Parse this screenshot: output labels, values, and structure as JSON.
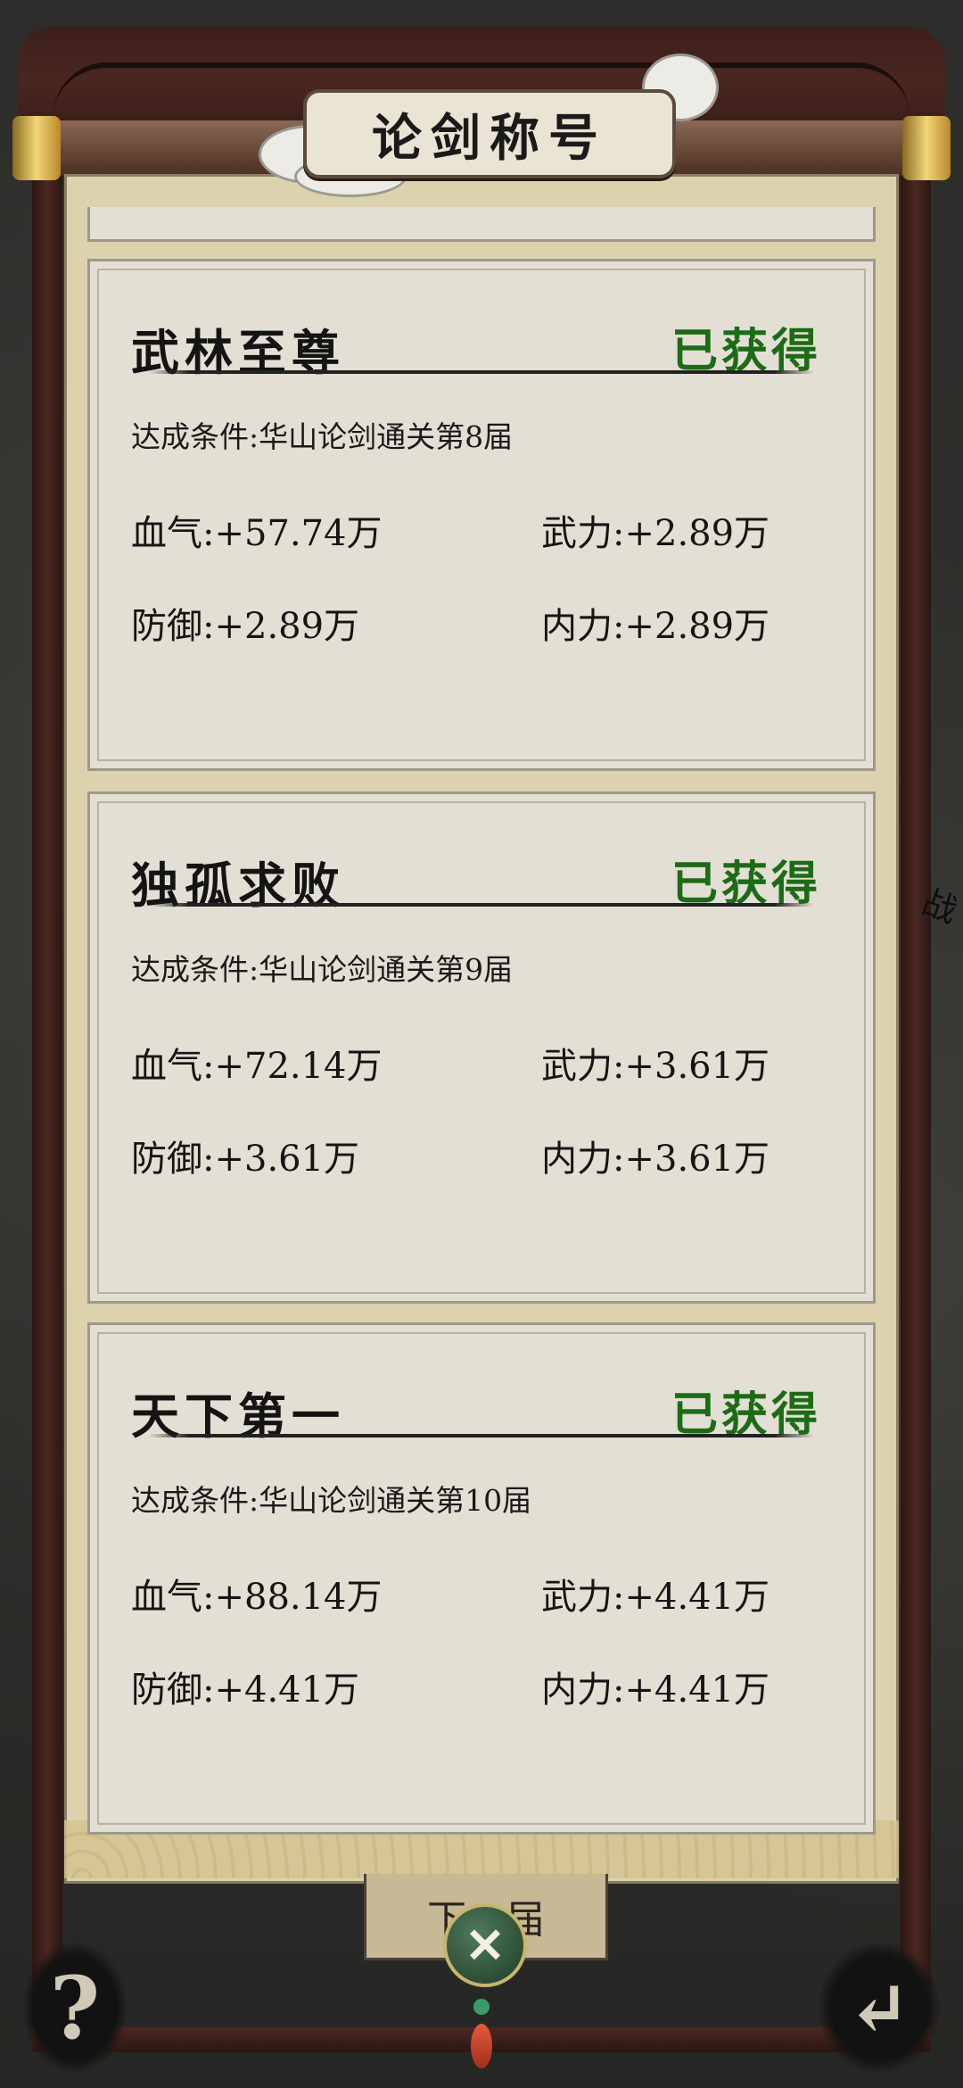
{
  "header": {
    "title": "论剑称号"
  },
  "side_label": "战",
  "cards": [
    {
      "name": "武林至尊",
      "status": "已获得",
      "condition": "达成条件:华山论剑通关第8届",
      "stats": {
        "blood": "血气:+57.74万",
        "force": "武力:+2.89万",
        "defense": "防御:+2.89万",
        "inner": "内力:+2.89万"
      }
    },
    {
      "name": "独孤求败",
      "status": "已获得",
      "condition": "达成条件:华山论剑通关第9届",
      "stats": {
        "blood": "血气:+72.14万",
        "force": "武力:+3.61万",
        "defense": "防御:+3.61万",
        "inner": "内力:+3.61万"
      }
    },
    {
      "name": "天下第一",
      "status": "已获得",
      "condition": "达成条件:华山论剑通关第10届",
      "stats": {
        "blood": "血气:+88.14万",
        "force": "武力:+4.41万",
        "defense": "防御:+4.41万",
        "inner": "内力:+4.41万"
      }
    }
  ],
  "footer": {
    "next_label": "下一届",
    "help_icon": "question-icon",
    "back_icon": "return-arrow-icon",
    "close_icon": "crossed-swords-icon"
  }
}
